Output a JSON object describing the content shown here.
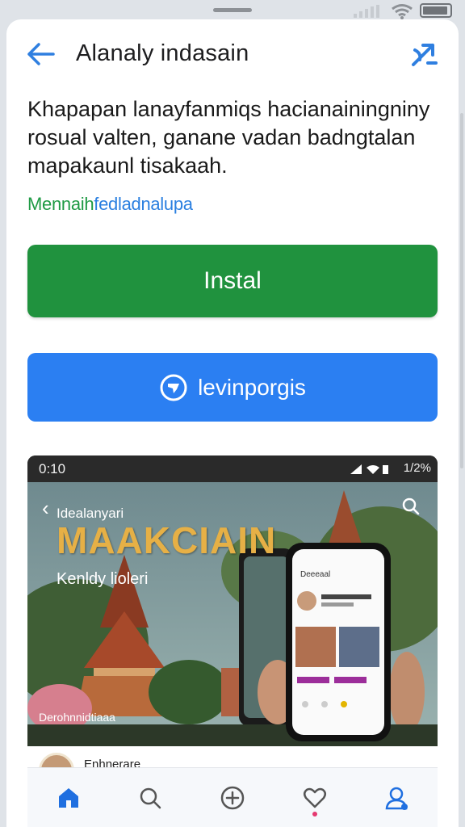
{
  "system_status": {
    "icons": [
      "cellular-signal-icon",
      "wifi-icon",
      "battery-icon"
    ]
  },
  "header": {
    "title": "Alanaly indasain",
    "back_icon": "arrow-left-icon",
    "share_icon": "share-icon"
  },
  "description": {
    "text": "Khapapan lanayfanmiqs hacianainingniny rosual valten, ganane vadan badngtalan mapakaunl tisakaah."
  },
  "meta": {
    "part1": "Mennaih",
    "part2": "fedladnalupa"
  },
  "actions": {
    "install_label": "Instal",
    "secondary_label": "levinporgis"
  },
  "preview": {
    "status_time": "0:10",
    "status_battery": "1/2%",
    "back_glyph": "‹",
    "subtitle": "Idealanyari",
    "brand": "MAAKCIAIN",
    "tagline": "Kenldy lioleri",
    "caption": "Derohnnidtiaaa",
    "post_author": "Enhnerare",
    "phone_header": "Deeeaal"
  },
  "bottom_nav": [
    {
      "name": "home",
      "icon": "home-icon",
      "active": true
    },
    {
      "name": "search",
      "icon": "search-icon",
      "active": false
    },
    {
      "name": "create",
      "icon": "plus-circle-icon",
      "active": false
    },
    {
      "name": "activity",
      "icon": "heart-icon",
      "active": false
    },
    {
      "name": "profile",
      "icon": "profile-icon",
      "active": false
    }
  ],
  "colors": {
    "install": "#20923e",
    "secondary": "#2b7ff2",
    "accent_blue": "#2a7fe0",
    "accent_green": "#1f9a44",
    "brand_gold": "#e6b046"
  }
}
